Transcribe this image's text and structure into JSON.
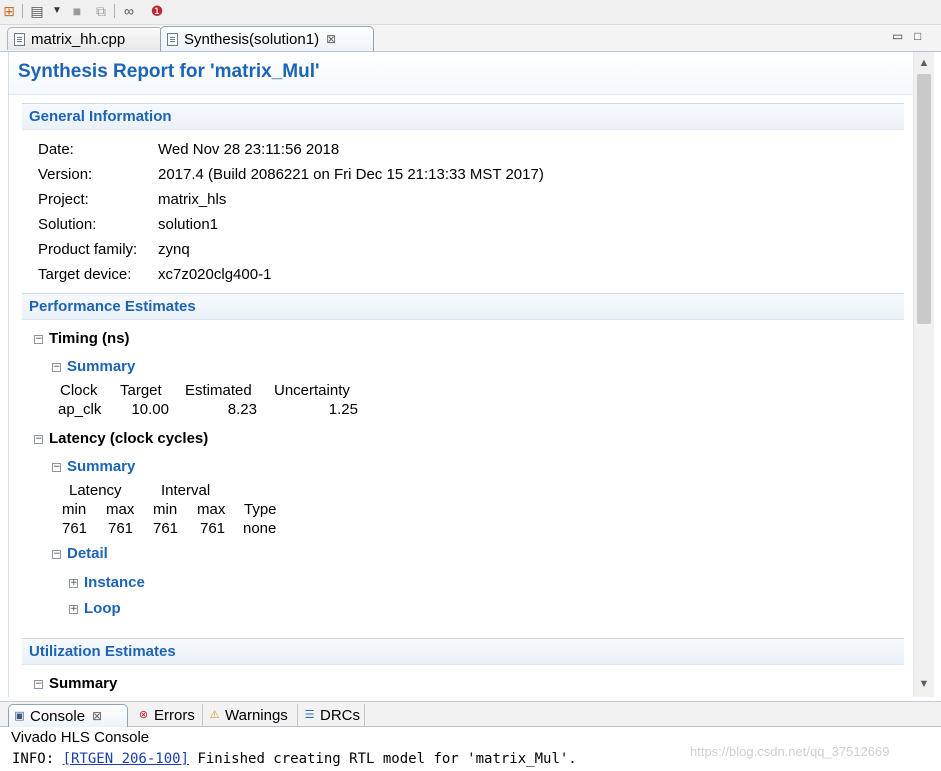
{
  "toolbar": {
    "icons": [
      "project-icon",
      "clipboard-icon",
      "dropdown-arrow-icon",
      "stop-icon",
      "compare-icon",
      "glasses-icon",
      "debug-icon"
    ]
  },
  "editor_tabs": [
    {
      "label": "matrix_hh.cpp",
      "active": false
    },
    {
      "label": "Synthesis(solution1)",
      "active": true,
      "close_glyph": "⊠"
    }
  ],
  "window_controls": {
    "minimize": "▭",
    "maximize": "□"
  },
  "report": {
    "title": "Synthesis Report for 'matrix_Mul'",
    "general": {
      "heading": "General Information",
      "rows": [
        {
          "label": "Date:",
          "value": "Wed Nov 28 23:11:56 2018"
        },
        {
          "label": "Version:",
          "value": "2017.4 (Build 2086221 on Fri Dec 15 21:13:33 MST 2017)"
        },
        {
          "label": "Project:",
          "value": "matrix_hls"
        },
        {
          "label": "Solution:",
          "value": "solution1"
        },
        {
          "label": "Product family:",
          "value": "zynq"
        },
        {
          "label": "Target device:",
          "value": "xc7z020clg400-1"
        }
      ]
    },
    "performance": {
      "heading": "Performance Estimates",
      "timing": {
        "label": "Timing (ns)",
        "summary_label": "Summary",
        "headers": [
          "Clock",
          "Target",
          "Estimated",
          "Uncertainty"
        ],
        "row": [
          "ap_clk",
          "10.00",
          "8.23",
          "1.25"
        ]
      },
      "latency": {
        "label": "Latency (clock cycles)",
        "summary_label": "Summary",
        "group_headers": [
          "Latency",
          "Interval"
        ],
        "headers": [
          "min",
          "max",
          "min",
          "max",
          "Type"
        ],
        "row": [
          "761",
          "761",
          "761",
          "761",
          "none"
        ],
        "detail_label": "Detail",
        "instance_label": "Instance",
        "loop_label": "Loop"
      }
    },
    "utilization": {
      "heading": "Utilization Estimates",
      "summary_label": "Summary"
    }
  },
  "bottom_tabs": [
    {
      "label": "Console",
      "active": true,
      "close_glyph": "⊠"
    },
    {
      "label": "Errors",
      "active": false
    },
    {
      "label": "Warnings",
      "active": false
    },
    {
      "label": "DRCs",
      "active": false
    }
  ],
  "console": {
    "title": "Vivado HLS Console",
    "line_prefix": "INFO: ",
    "line_link": "[RTGEN 206-100]",
    "line_text": " Finished creating RTL model for 'matrix_Mul'."
  },
  "watermark": "https://blog.csdn.net/qq_37512669"
}
